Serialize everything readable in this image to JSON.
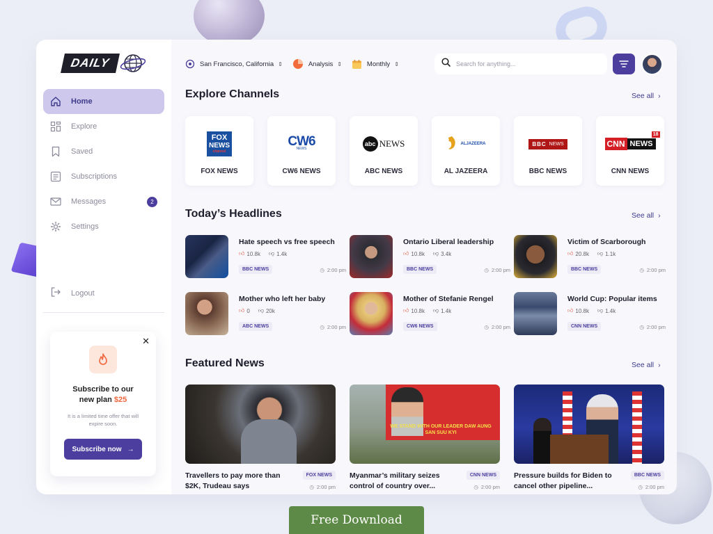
{
  "brand": {
    "logo_text": "DAILY"
  },
  "sidebar": {
    "items": [
      {
        "label": "Home",
        "icon": "home-icon",
        "active": true
      },
      {
        "label": "Explore",
        "icon": "grid-icon"
      },
      {
        "label": "Saved",
        "icon": "bookmark-icon"
      },
      {
        "label": "Subscriptions",
        "icon": "list-icon"
      },
      {
        "label": "Messages",
        "icon": "mail-icon",
        "badge": "2"
      },
      {
        "label": "Settings",
        "icon": "gear-icon"
      }
    ],
    "logout_label": "Logout"
  },
  "promo": {
    "title_line1": "Subscribe to our",
    "title_line2": "new plan",
    "price": "$25",
    "subtitle": "It is a limited time offer that will expire soon.",
    "button_label": "Subscribe now"
  },
  "topbar": {
    "location": "San Francisco, California",
    "analysis": "Analysis",
    "period": "Monthly",
    "search_placeholder": "Search for anything..."
  },
  "sections": {
    "channels_title": "Explore Channels",
    "headlines_title": "Today’s Headlines",
    "featured_title": "Featured News",
    "see_all": "See all"
  },
  "channels": [
    {
      "name": "FOX NEWS",
      "logo_line1": "FOX",
      "logo_line2": "NEWS",
      "logo_line3": "channel"
    },
    {
      "name": "CW6 NEWS",
      "logo_line1": "CW6",
      "logo_line2": "NEWS"
    },
    {
      "name": "ABC NEWS",
      "logo_line1": "abc",
      "logo_line2": "NEWS"
    },
    {
      "name": "AL JAZEERA",
      "logo_line1": "ALJAZEERA"
    },
    {
      "name": "BBC NEWS",
      "logo_line1": "BBC",
      "logo_line2": "NEWS"
    },
    {
      "name": "CNN NEWS",
      "logo_line1": "CNN",
      "logo_line2": "NEWS",
      "logo_line3": "18"
    }
  ],
  "headlines": [
    {
      "title": "Hate speech vs free speech",
      "likes": "10.8k",
      "dislikes": "1.4k",
      "tag": "BBC NEWS",
      "time": "2:00 pm"
    },
    {
      "title": "Ontario Liberal leadership",
      "likes": "10.8k",
      "dislikes": "3.4k",
      "tag": "BBC NEWS",
      "time": "2:00 pm"
    },
    {
      "title": "Victim of Scarborough",
      "likes": "20.8k",
      "dislikes": "1.1k",
      "tag": "BBC NEWS",
      "time": "2:00 pm"
    },
    {
      "title": "Mother who left her baby",
      "likes": "0",
      "dislikes": "20k",
      "tag": "ABC NEWS",
      "time": "2:00 pm"
    },
    {
      "title": "Mother of Stefanie Rengel",
      "likes": "10.8k",
      "dislikes": "1.4k",
      "tag": "CW6 NEWS",
      "time": "2:00 pm"
    },
    {
      "title": "World Cup: Popular items",
      "likes": "10.8k",
      "dislikes": "1.4k",
      "tag": "CNN NEWS",
      "time": "2:00 pm"
    }
  ],
  "featured": [
    {
      "title": "Travellers to pay more than $2K, Trudeau says",
      "tag": "FOX NEWS",
      "time": "2:00 pm"
    },
    {
      "title": "Myanmar’s military seizes control of country over...",
      "tag": "CNN NEWS",
      "time": "2:00 pm",
      "banner_text": "WE STAND WITH OUR LEADER DAW AUNG SAN SUU KYI"
    },
    {
      "title": "Pressure builds for Biden to cancel other pipeline...",
      "tag": "BBC NEWS",
      "time": "2:00 pm"
    }
  ],
  "download_label": "Free Download",
  "colors": {
    "accent": "#4b3e9e",
    "active_bg": "#cdc8ec",
    "price": "#f0643c",
    "download": "#5e8a47"
  }
}
